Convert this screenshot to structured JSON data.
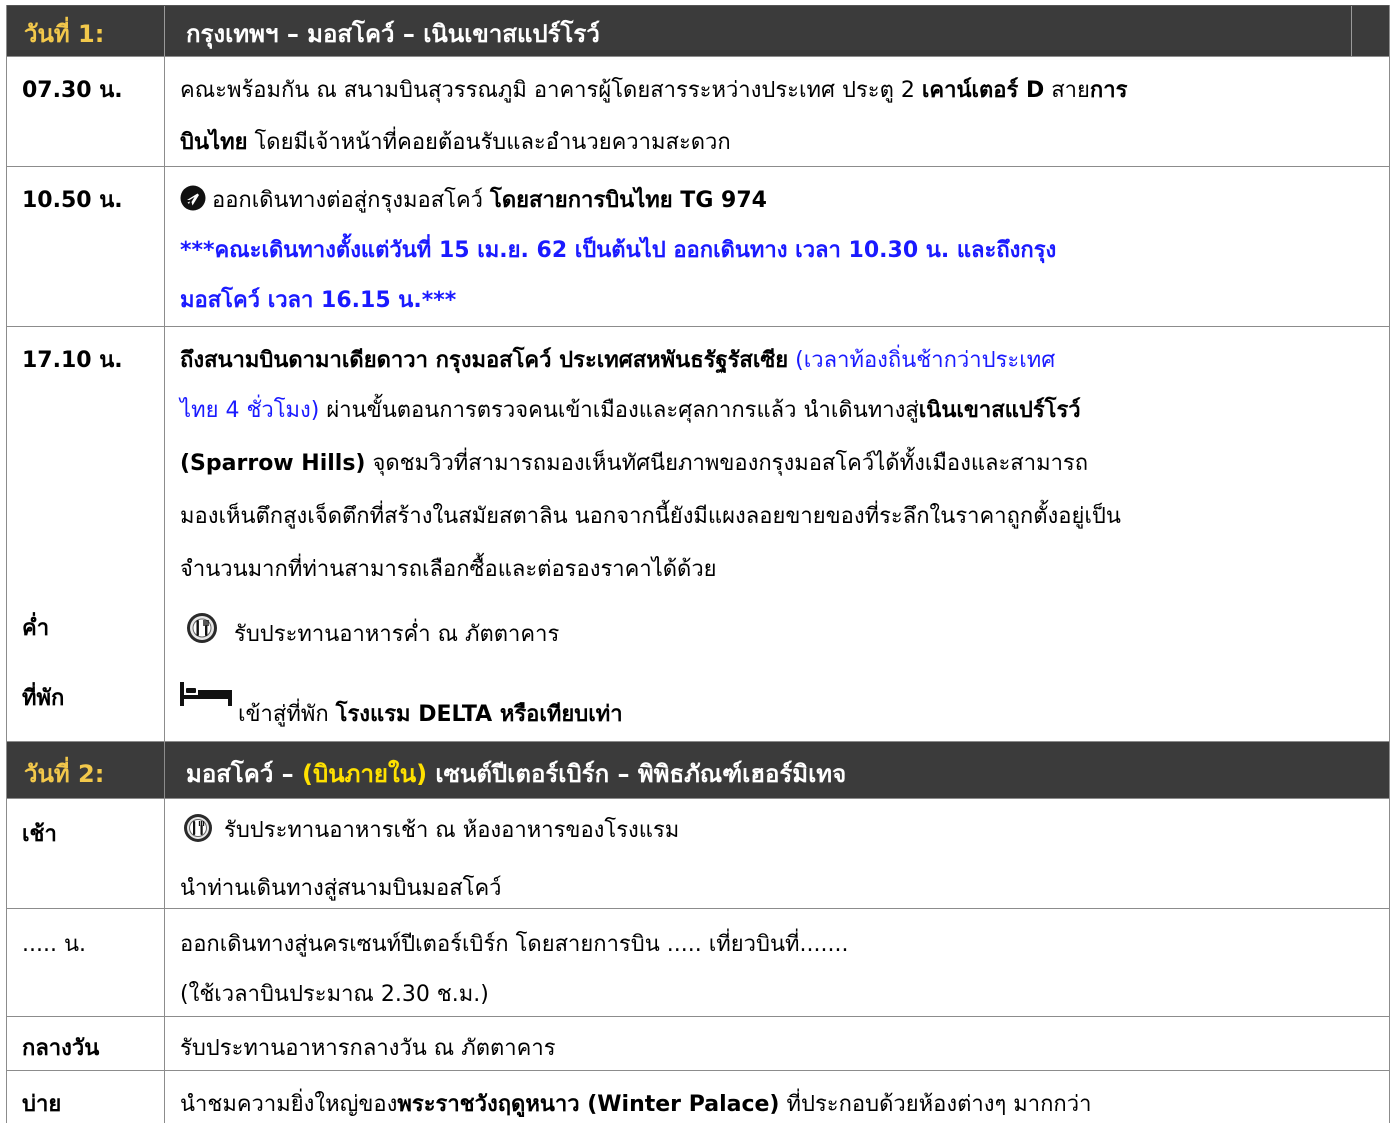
{
  "day1": {
    "label": "วันที่ 1:",
    "title": "กรุงเทพฯ – มอสโคว์ – เนินเขาสแปร์โรว์",
    "rows": {
      "r1": {
        "time": "07.30 น.",
        "l1a": "คณะพร้อมกัน ณ สนามบินสุวรรณภูมิ อาคารผู้โดยสารระหว่างประเทศ ประตู 2 ",
        "l1b": "เคาน์เตอร์ D",
        "l1c": " สาย",
        "l1d": "การ",
        "l2a": "บินไทย",
        "l2b": " โดยมีเจ้าหน้าที่คอยต้อนรับและอำนวยความสะดวก"
      },
      "r2": {
        "time": "10.50 น.",
        "l1a": "ออกเดินทางต่อสู่กรุงมอสโคว์ ",
        "l1b": "โดยสายการบินไทย TG 974",
        "l2": "***คณะเดินทางตั้งแต่วันที่ 15 เม.ย. 62 เป็นต้นไป ออกเดินทาง เวลา 10.30 น. และถึงกรุง",
        "l3": "มอสโคว์ เวลา 16.15 น.***"
      },
      "r3": {
        "time": "17.10 น.",
        "l1a": "ถึงสนามบินดามาเดียดาวา กรุงมอสโคว์ ประเทศสหพันธรัฐรัสเซีย",
        "l1b": " (เวลาท้องถิ่นช้ากว่าประเทศ",
        "l2a": "ไทย 4 ชั่วโมง)",
        "l2b": " ผ่านขั้นตอนการตรวจคนเข้าเมืองและศุลกากรแล้ว นำเดินทางสู่",
        "l2c": "เนินเขาสแปร์โรว์",
        "l3a": "(Sparrow Hills)",
        "l3b": " จุดชมวิวที่สามารถมองเห็นทัศนียภาพของกรุงมอสโคว์ได้ทั้งเมืองและสามารถ",
        "l4": "มองเห็นตึกสูงเจ็ดตึกที่สร้างในสมัยสตาลิน นอกจากนี้ยังมีแผงลอยขายของที่ระลึกในราคาถูกตั้งอยู่เป็น",
        "l5": "จำนวนมากที่ท่านสามารถเลือกซื้อและต่อรองราคาได้ด้วย"
      },
      "r4": {
        "time": "ค่ำ",
        "text": "รับประทานอาหารค่ำ ณ ภัตตาคาร"
      },
      "r5": {
        "time": "ที่พัก",
        "texta": "เข้าสู่ที่พัก ",
        "textb": "โรงแรม DELTA หรือเทียบเท่า"
      }
    }
  },
  "day2": {
    "label": "วันที่ 2:",
    "title_a": "มอสโคว์ – ",
    "title_b": "(บินภายใน)",
    "title_c": " เซนต์ปีเตอร์เบิร์ก – พิพิธภัณฑ์เฮอร์มิเทจ",
    "rows": {
      "r1": {
        "time": "เช้า",
        "text": "รับประทานอาหารเช้า ณ ห้องอาหารของโรงแรม"
      },
      "r2": {
        "text": "นำท่านเดินทางสู่สนามบินมอสโคว์"
      },
      "r3": {
        "time": "..... น.",
        "l1": "ออกเดินทางสู่นครเซนท์ปีเตอร์เบิร์ก โดยสายการบิน ..... เที่ยวบินที่.......",
        "l2": "(ใช้เวลาบินประมาณ 2.30 ช.ม.)"
      },
      "r4": {
        "time": "กลางวัน",
        "text": "รับประทานอาหารกลางวัน ณ ภัตตาคาร"
      },
      "r5": {
        "time": "บ่าย",
        "ta": "นำชมความยิ่งใหญ่ของ",
        "tb": "พระราชวังฤดูหนาว (Winter Palace)",
        "tc": " ที่ประกอบด้วยห้องต่างๆ มากกว่า"
      }
    }
  },
  "icons": {
    "plane": "airplane-icon",
    "meal": "meal-icon",
    "bed": "bed-icon"
  },
  "colors": {
    "header_bg": "#3b3b3b",
    "day_label": "#f2c84b",
    "highlight_yellow": "#ffe100",
    "note_blue": "#1a1aff"
  }
}
